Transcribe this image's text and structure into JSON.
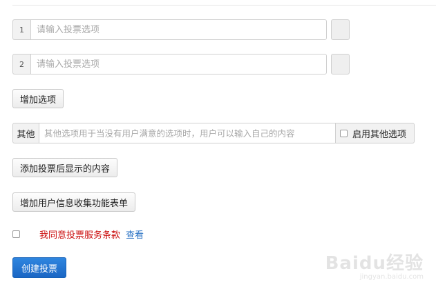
{
  "options": [
    {
      "number": "1",
      "placeholder": "请输入投票选项"
    },
    {
      "number": "2",
      "placeholder": "请输入投票选项"
    }
  ],
  "add_option_label": "增加选项",
  "other": {
    "label": "其他",
    "placeholder": "其他选项用于当没有用户满意的选项时，用户可以输入自己的内容",
    "enable_label": "启用其他选项",
    "enabled": false
  },
  "add_post_vote_content_label": "添加投票后显示的内容",
  "add_user_info_form_label": "增加用户信息收集功能表单",
  "agreement": {
    "checked": false,
    "text": "我同意投票服务条款",
    "view_link": "查看"
  },
  "create_vote_label": "创建投票",
  "watermark": {
    "logo_text": "Baidu经验",
    "url": "jingyan.baidu.com"
  },
  "colors": {
    "primary": "#1a66c4",
    "agreement_text": "#cc1111",
    "link": "#2a72c4"
  }
}
